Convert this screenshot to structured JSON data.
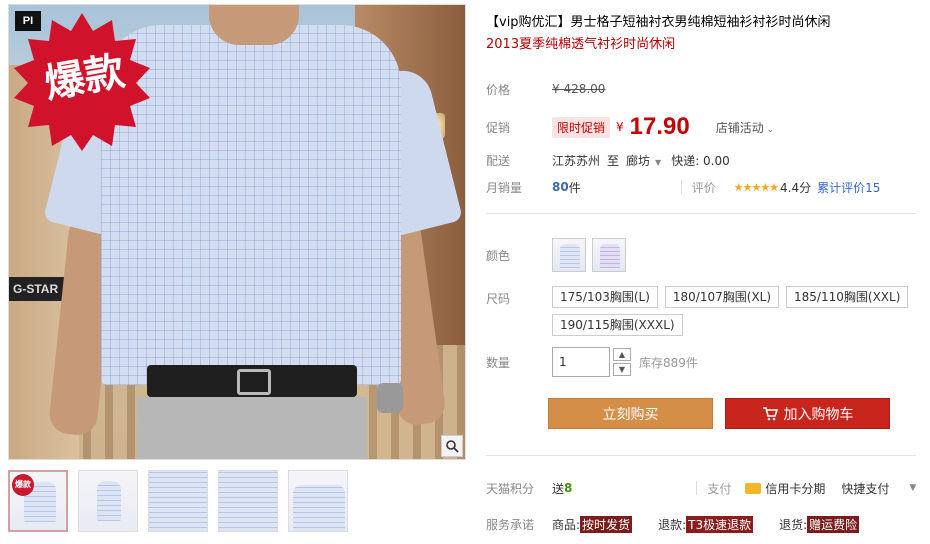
{
  "gallery": {
    "badge_text": "爆款",
    "corner_logo": "PI",
    "bg_sign": "G-STAR",
    "thumb_badge": "爆款"
  },
  "product": {
    "title_line1": "【vip购优汇】男士格子短袖衬衣男纯棉短袖衫衬衫时尚休闲",
    "title_line2": "2013夏季纯棉透气衬衫时尚休闲"
  },
  "price": {
    "label": "价格",
    "original": "¥ 428.00",
    "promo_label": "促销",
    "promo_tag": "限时促销",
    "currency": "¥",
    "current": "17.90",
    "shop_activity": "店铺活动"
  },
  "delivery": {
    "label": "配送",
    "from": "江苏苏州",
    "to_word": "至",
    "to": "廊坊",
    "express": "快递: 0.00"
  },
  "sales": {
    "label": "月销量",
    "count": "80",
    "unit": "件",
    "rating_label": "评价",
    "stars": "★★★★★",
    "score": "4.4分",
    "reviews": "累计评价15"
  },
  "color": {
    "label": "颜色"
  },
  "size": {
    "label": "尺码",
    "options": [
      "175/103胸围(L)",
      "180/107胸围(XL)",
      "185/110胸围(XXL)",
      "190/115胸围(XXXL)"
    ]
  },
  "quantity": {
    "label": "数量",
    "value": "1",
    "stock": "库存889件"
  },
  "buttons": {
    "buy": "立刻购买",
    "cart": "加入购物车"
  },
  "points": {
    "label": "天猫积分",
    "send": "送",
    "value": "8",
    "pay_label": "支付",
    "credit": "信用卡分期",
    "quick_pay": "快捷支付"
  },
  "service": {
    "label": "服务承诺",
    "goods": "商品:",
    "goods_tag": "按时发货",
    "refund": "退款:",
    "refund_tag": "T3极速退款",
    "return": "退货:",
    "return_tag": "赠运费险"
  },
  "colors": {
    "price_red": "#c40000",
    "buy_button": "#d48e48",
    "cart_button": "#c8261d"
  }
}
